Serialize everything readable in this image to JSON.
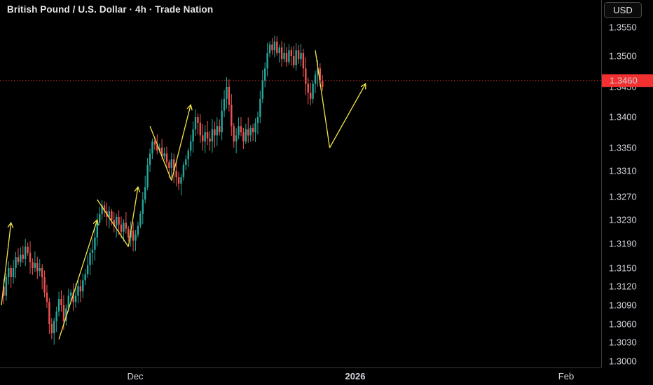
{
  "header": {
    "title": "British Pound / U.S. Dollar · 4h · Trade Nation",
    "currency_button": "USD"
  },
  "colors": {
    "background": "#000000",
    "up_candle": "#26a69a",
    "down_candle": "#ef5350",
    "drawing": "#f2e44a",
    "price_line": "#ef3b3b",
    "price_label_bg": "#f23030"
  },
  "chart_data": {
    "type": "candlestick",
    "y_axis": {
      "ticks": [
        "1.3550",
        "1.3500",
        "1.3450",
        "1.3400",
        "1.3350",
        "1.3310",
        "1.3270",
        "1.3230",
        "1.3190",
        "1.3150",
        "1.3120",
        "1.3090",
        "1.3060",
        "1.3030",
        "1.3000"
      ]
    },
    "x_axis": {
      "ticks": [
        {
          "label": "Dec",
          "bold": false
        },
        {
          "label": "2026",
          "bold": true
        },
        {
          "label": "Feb",
          "bold": false
        }
      ]
    },
    "current_price": "1.3460",
    "price_path": [
      1.312,
      1.3105,
      1.3135,
      1.315,
      1.3135,
      1.315,
      1.3168,
      1.316,
      1.3172,
      1.3165,
      1.3185,
      1.3175,
      1.316,
      1.315,
      1.3158,
      1.3145,
      1.315,
      1.3135,
      1.311,
      1.3095,
      1.306,
      1.3045,
      1.3065,
      1.308,
      1.31,
      1.309,
      1.3065,
      1.3085,
      1.3105,
      1.311,
      1.3095,
      1.3105,
      1.312,
      1.3112,
      1.313,
      1.314,
      1.3155,
      1.3175,
      1.318,
      1.32,
      1.3225,
      1.324,
      1.3255,
      1.3245,
      1.3235,
      1.3245,
      1.323,
      1.322,
      1.3235,
      1.3222,
      1.321,
      1.3225,
      1.3215,
      1.32,
      1.3212,
      1.3195,
      1.3205,
      1.322,
      1.324,
      1.3265,
      1.3285,
      1.332,
      1.334,
      1.336,
      1.3355,
      1.3345,
      1.335,
      1.3335,
      1.334,
      1.3325,
      1.3315,
      1.333,
      1.331,
      1.33,
      1.329,
      1.33,
      1.332,
      1.333,
      1.3345,
      1.336,
      1.338,
      1.34,
      1.339,
      1.337,
      1.336,
      1.3375,
      1.3365,
      1.336,
      1.338,
      1.337,
      1.3385,
      1.3375,
      1.341,
      1.343,
      1.345,
      1.342,
      1.3385,
      1.336,
      1.337,
      1.3385,
      1.3375,
      1.336,
      1.338,
      1.337,
      1.3382,
      1.3375,
      1.339,
      1.34,
      1.343,
      1.346,
      1.348,
      1.3505,
      1.352,
      1.351,
      1.3525,
      1.3505,
      1.3515,
      1.3495,
      1.3505,
      1.349,
      1.351,
      1.35,
      1.3485,
      1.351,
      1.3495,
      1.3505,
      1.348,
      1.3455,
      1.344,
      1.343,
      1.3455,
      1.347,
      1.348,
      1.346,
      1.345
    ],
    "annotations": [
      {
        "type": "arrow",
        "points": [
          [
            "1.3090",
            0
          ],
          [
            "1.3225",
            4
          ]
        ]
      },
      {
        "type": "arrow",
        "points": [
          [
            "1.3035",
            24
          ],
          [
            "1.3230",
            40
          ]
        ]
      },
      {
        "type": "polyline",
        "points": [
          [
            "1.3265",
            40
          ],
          [
            "1.3185",
            53
          ]
        ]
      },
      {
        "type": "arrow",
        "points": [
          [
            "1.3185",
            53
          ],
          [
            "1.3285",
            57
          ]
        ]
      },
      {
        "type": "polyline",
        "points": [
          [
            "1.3385",
            62
          ],
          [
            "1.3295",
            71
          ]
        ]
      },
      {
        "type": "arrow",
        "points": [
          [
            "1.3295",
            71
          ],
          [
            "1.3420",
            79
          ]
        ]
      },
      {
        "type": "polyline",
        "points": [
          [
            "1.3510",
            131
          ],
          [
            "1.3350",
            137
          ]
        ]
      },
      {
        "type": "arrow",
        "points": [
          [
            "1.3350",
            137
          ],
          [
            "1.3455",
            152
          ]
        ]
      }
    ]
  }
}
